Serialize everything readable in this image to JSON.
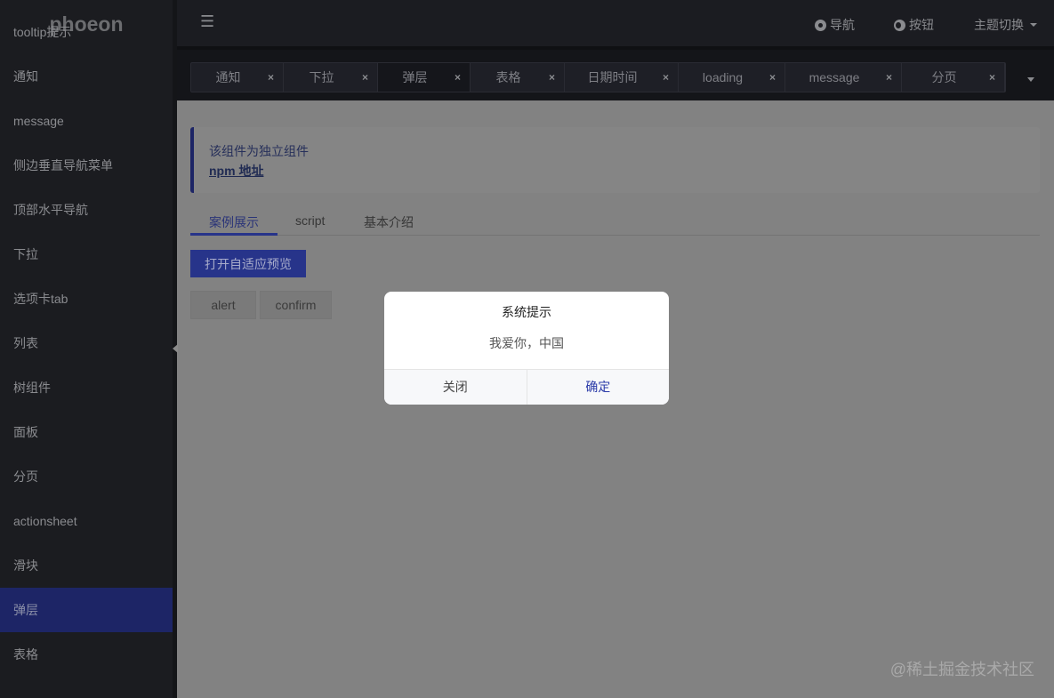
{
  "logo": "phoeon",
  "sidebar": {
    "items": [
      {
        "label": "tooltip提示"
      },
      {
        "label": "通知"
      },
      {
        "label": "message"
      },
      {
        "label": "侧边垂直导航菜单"
      },
      {
        "label": "顶部水平导航"
      },
      {
        "label": "下拉"
      },
      {
        "label": "选项卡tab"
      },
      {
        "label": "列表"
      },
      {
        "label": "树组件"
      },
      {
        "label": "面板"
      },
      {
        "label": "分页"
      },
      {
        "label": "actionsheet"
      },
      {
        "label": "滑块"
      },
      {
        "label": "弹层",
        "active": true
      },
      {
        "label": "表格"
      }
    ]
  },
  "header": {
    "menu_icon": "☰",
    "nav": "导航",
    "buttons": "按钮",
    "theme": "主题切换"
  },
  "tabs": [
    {
      "label": "通知"
    },
    {
      "label": "下拉"
    },
    {
      "label": "弹层",
      "active": true
    },
    {
      "label": "表格"
    },
    {
      "label": "日期时间"
    },
    {
      "label": "loading"
    },
    {
      "label": "message"
    },
    {
      "label": "分页"
    }
  ],
  "tab_close": "×",
  "notice": {
    "text": "该组件为独立组件",
    "link": "npm 地址"
  },
  "content_tabs": [
    "案例展示",
    "script",
    "基本介绍"
  ],
  "buttons": {
    "preview": "打开自适应预览",
    "alert": "alert",
    "confirm": "confirm"
  },
  "dialog": {
    "title": "系统提示",
    "message": "我爱你，中国",
    "cancel": "关闭",
    "ok": "确定"
  },
  "watermark": "@稀土掘金技术社区",
  "colors": {
    "accent": "#27348a",
    "sidebar": "#1b1c20"
  }
}
